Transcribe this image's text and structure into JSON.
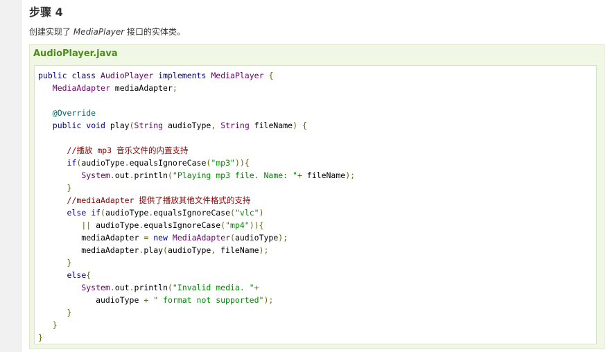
{
  "step": {
    "title": "步骤 4",
    "desc_prefix": "创建实现了 ",
    "desc_em": "MediaPlayer",
    "desc_suffix": " 接口的实体类。"
  },
  "code": {
    "filename": "AudioPlayer.java",
    "lines": [
      [
        [
          "kw",
          "public"
        ],
        [
          "pln",
          " "
        ],
        [
          "kw",
          "class"
        ],
        [
          "pln",
          " "
        ],
        [
          "typ",
          "AudioPlayer"
        ],
        [
          "pln",
          " "
        ],
        [
          "kw",
          "implements"
        ],
        [
          "pln",
          " "
        ],
        [
          "typ",
          "MediaPlayer"
        ],
        [
          "pln",
          " "
        ],
        [
          "pun",
          "{"
        ]
      ],
      [
        [
          "pln",
          "   "
        ],
        [
          "typ",
          "MediaAdapter"
        ],
        [
          "pln",
          " mediaAdapter"
        ],
        [
          "pun",
          ";"
        ]
      ],
      [],
      [
        [
          "pln",
          "   "
        ],
        [
          "lit",
          "@Override"
        ]
      ],
      [
        [
          "pln",
          "   "
        ],
        [
          "kw",
          "public"
        ],
        [
          "pln",
          " "
        ],
        [
          "kw",
          "void"
        ],
        [
          "pln",
          " play"
        ],
        [
          "pun",
          "("
        ],
        [
          "typ",
          "String"
        ],
        [
          "pln",
          " audioType"
        ],
        [
          "pun",
          ","
        ],
        [
          "pln",
          " "
        ],
        [
          "typ",
          "String"
        ],
        [
          "pln",
          " fileName"
        ],
        [
          "pun",
          ")"
        ],
        [
          "pln",
          " "
        ],
        [
          "pun",
          "{"
        ]
      ],
      [],
      [
        [
          "pln",
          "      "
        ],
        [
          "com",
          "//播放 mp3 音乐文件的内置支持"
        ]
      ],
      [
        [
          "pln",
          "      "
        ],
        [
          "kw",
          "if"
        ],
        [
          "pun",
          "("
        ],
        [
          "pln",
          "audioType"
        ],
        [
          "pun",
          "."
        ],
        [
          "pln",
          "equalsIgnoreCase"
        ],
        [
          "pun",
          "("
        ],
        [
          "str",
          "\"mp3\""
        ],
        [
          "pun",
          ")){"
        ]
      ],
      [
        [
          "pln",
          "         "
        ],
        [
          "typ",
          "System"
        ],
        [
          "pun",
          "."
        ],
        [
          "pln",
          "out"
        ],
        [
          "pun",
          "."
        ],
        [
          "pln",
          "println"
        ],
        [
          "pun",
          "("
        ],
        [
          "str",
          "\"Playing mp3 file. Name: \""
        ],
        [
          "pun",
          "+"
        ],
        [
          "pln",
          " fileName"
        ],
        [
          "pun",
          ");"
        ]
      ],
      [
        [
          "pln",
          "      "
        ],
        [
          "pun",
          "}"
        ]
      ],
      [
        [
          "pln",
          "      "
        ],
        [
          "com",
          "//mediaAdapter 提供了播放其他文件格式的支持"
        ]
      ],
      [
        [
          "pln",
          "      "
        ],
        [
          "kw",
          "else"
        ],
        [
          "pln",
          " "
        ],
        [
          "kw",
          "if"
        ],
        [
          "pun",
          "("
        ],
        [
          "pln",
          "audioType"
        ],
        [
          "pun",
          "."
        ],
        [
          "pln",
          "equalsIgnoreCase"
        ],
        [
          "pun",
          "("
        ],
        [
          "str",
          "\"vlc\""
        ],
        [
          "pun",
          ")"
        ]
      ],
      [
        [
          "pln",
          "         "
        ],
        [
          "pun",
          "||"
        ],
        [
          "pln",
          " audioType"
        ],
        [
          "pun",
          "."
        ],
        [
          "pln",
          "equalsIgnoreCase"
        ],
        [
          "pun",
          "("
        ],
        [
          "str",
          "\"mp4\""
        ],
        [
          "pun",
          ")){"
        ]
      ],
      [
        [
          "pln",
          "         mediaAdapter "
        ],
        [
          "pun",
          "="
        ],
        [
          "pln",
          " "
        ],
        [
          "kw",
          "new"
        ],
        [
          "pln",
          " "
        ],
        [
          "typ",
          "MediaAdapter"
        ],
        [
          "pun",
          "("
        ],
        [
          "pln",
          "audioType"
        ],
        [
          "pun",
          ");"
        ]
      ],
      [
        [
          "pln",
          "         mediaAdapter"
        ],
        [
          "pun",
          "."
        ],
        [
          "pln",
          "play"
        ],
        [
          "pun",
          "("
        ],
        [
          "pln",
          "audioType"
        ],
        [
          "pun",
          ","
        ],
        [
          "pln",
          " fileName"
        ],
        [
          "pun",
          ");"
        ]
      ],
      [
        [
          "pln",
          "      "
        ],
        [
          "pun",
          "}"
        ]
      ],
      [
        [
          "pln",
          "      "
        ],
        [
          "kw",
          "else"
        ],
        [
          "pun",
          "{"
        ]
      ],
      [
        [
          "pln",
          "         "
        ],
        [
          "typ",
          "System"
        ],
        [
          "pun",
          "."
        ],
        [
          "pln",
          "out"
        ],
        [
          "pun",
          "."
        ],
        [
          "pln",
          "println"
        ],
        [
          "pun",
          "("
        ],
        [
          "str",
          "\"Invalid media. \""
        ],
        [
          "pun",
          "+"
        ]
      ],
      [
        [
          "pln",
          "            audioType "
        ],
        [
          "pun",
          "+"
        ],
        [
          "pln",
          " "
        ],
        [
          "str",
          "\" format not supported\""
        ],
        [
          "pun",
          ");"
        ]
      ],
      [
        [
          "pln",
          "      "
        ],
        [
          "pun",
          "}"
        ]
      ],
      [
        [
          "pln",
          "   "
        ],
        [
          "pun",
          "}"
        ]
      ],
      [
        [
          "pun",
          "}"
        ]
      ]
    ]
  }
}
